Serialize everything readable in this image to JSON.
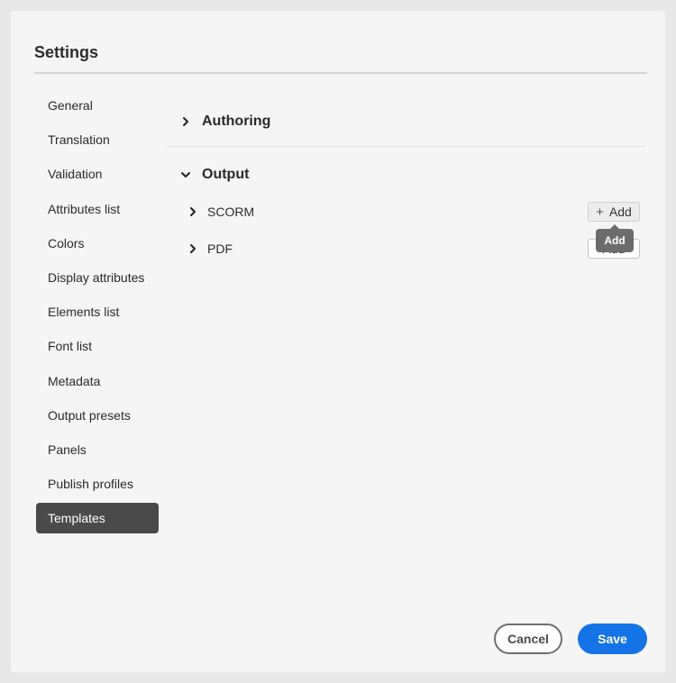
{
  "dialog": {
    "title": "Settings"
  },
  "sidebar": {
    "items": [
      {
        "label": "General"
      },
      {
        "label": "Translation"
      },
      {
        "label": "Validation"
      },
      {
        "label": "Attributes list"
      },
      {
        "label": "Colors"
      },
      {
        "label": "Display attributes"
      },
      {
        "label": "Elements list"
      },
      {
        "label": "Font list"
      },
      {
        "label": "Metadata"
      },
      {
        "label": "Output presets"
      },
      {
        "label": "Panels"
      },
      {
        "label": "Publish profiles"
      },
      {
        "label": "Templates",
        "selected": true
      }
    ]
  },
  "main": {
    "sections": [
      {
        "label": "Authoring",
        "expanded": false,
        "icon": "chevron-right-icon"
      },
      {
        "label": "Output",
        "expanded": true,
        "icon": "chevron-down-icon",
        "children": [
          {
            "label": "SCORM",
            "expanded": false,
            "add_label": "Add",
            "add_icon": "plus-icon"
          },
          {
            "label": "PDF",
            "expanded": false,
            "add_label": "Add"
          }
        ]
      }
    ],
    "tooltip": "Add"
  },
  "footer": {
    "cancel_label": "Cancel",
    "save_label": "Save"
  },
  "colors": {
    "accent": "#1473e6",
    "selected_nav_bg": "#4a4a4a",
    "tooltip_bg": "#6c6c6c"
  }
}
